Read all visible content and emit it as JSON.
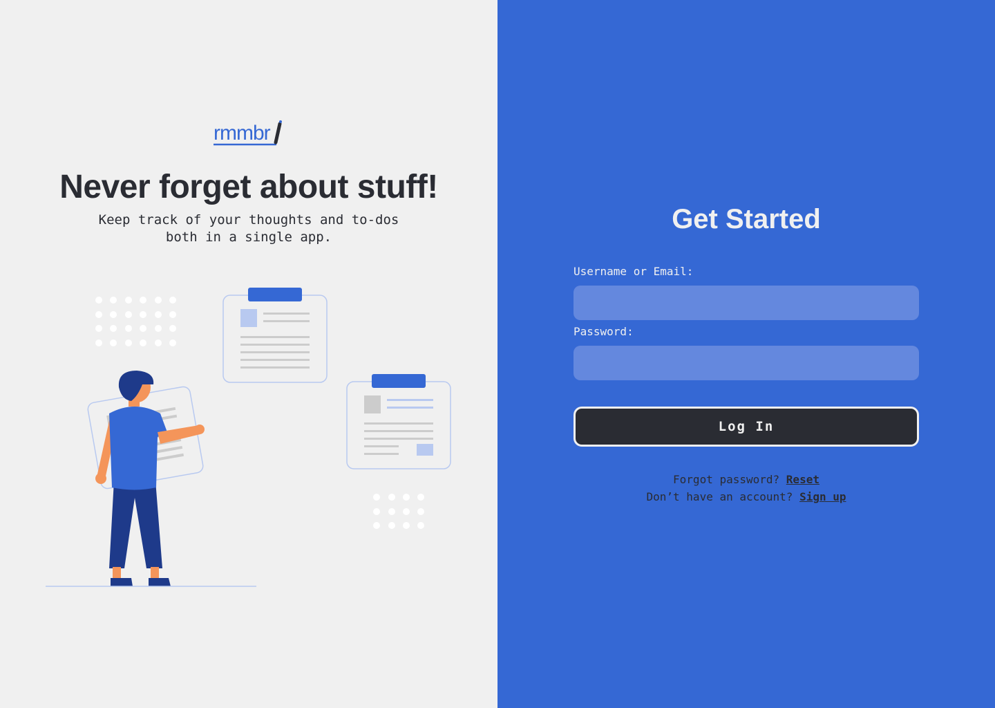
{
  "brand": {
    "logo_text": "rmmbr",
    "accent": "#3568d4",
    "dark": "#2a2c33",
    "light": "#f0f0f0"
  },
  "hero": {
    "title": "Never forget about stuff!",
    "subtitle": "Keep track of your thoughts and to-dos\nboth in a single app."
  },
  "form": {
    "title": "Get Started",
    "username_label": "Username or Email:",
    "username_value": "",
    "password_label": "Password:",
    "password_value": "",
    "login_label": "Log In",
    "forgot_text": "Forgot password?",
    "reset_link": "Reset",
    "noaccount_text": "Don’t have an account?",
    "signup_link": "Sign up"
  }
}
